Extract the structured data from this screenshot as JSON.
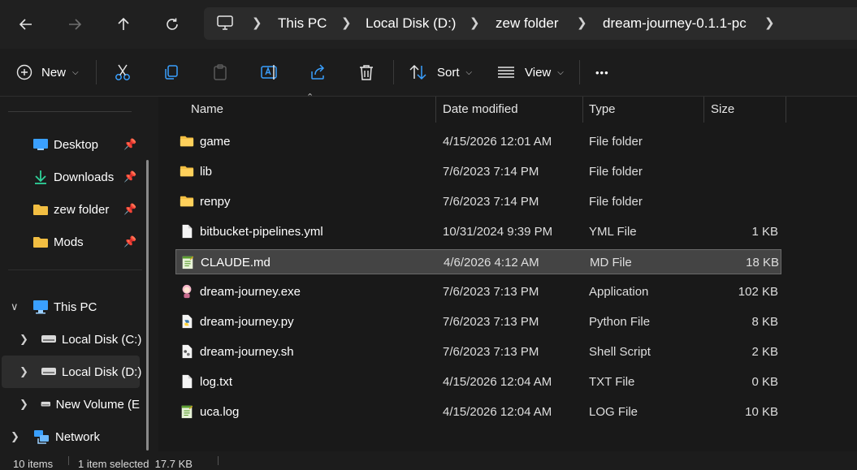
{
  "nav": {
    "back_icon": "arrow-left-icon",
    "forward_icon": "arrow-right-icon",
    "up_icon": "arrow-up-icon",
    "refresh_icon": "refresh-icon"
  },
  "breadcrumb": [
    "This PC",
    "Local Disk (D:)",
    "zew folder",
    "dream-journey-0.1.1-pc"
  ],
  "toolbar": {
    "new_label": "New",
    "sort_label": "Sort",
    "view_label": "View",
    "more_label": "•••"
  },
  "sidebar": {
    "quick": [
      {
        "label": "Desktop",
        "icon": "desktop-icon"
      },
      {
        "label": "Downloads",
        "icon": "download-icon"
      },
      {
        "label": "zew folder",
        "icon": "folder-icon"
      },
      {
        "label": "Mods",
        "icon": "folder-icon"
      }
    ],
    "this_pc": "This PC",
    "drives": [
      "Local Disk (C:)",
      "Local Disk (D:)",
      "New Volume (E"
    ],
    "network": "Network"
  },
  "columns": {
    "name": "Name",
    "date": "Date modified",
    "type": "Type",
    "size": "Size"
  },
  "files": [
    {
      "name": "game",
      "date": "4/15/2026 12:01 AM",
      "type": "File folder",
      "size": "",
      "icon": "folder"
    },
    {
      "name": "lib",
      "date": "7/6/2023 7:14 PM",
      "type": "File folder",
      "size": "",
      "icon": "folder"
    },
    {
      "name": "renpy",
      "date": "7/6/2023 7:14 PM",
      "type": "File folder",
      "size": "",
      "icon": "folder"
    },
    {
      "name": "bitbucket-pipelines.yml",
      "date": "10/31/2024 9:39 PM",
      "type": "YML File",
      "size": "1 KB",
      "icon": "file"
    },
    {
      "name": "CLAUDE.md",
      "date": "4/6/2026 4:12 AM",
      "type": "MD File",
      "size": "18 KB",
      "icon": "notepad",
      "selected": true
    },
    {
      "name": "dream-journey.exe",
      "date": "7/6/2023 7:13 PM",
      "type": "Application",
      "size": "102 KB",
      "icon": "app"
    },
    {
      "name": "dream-journey.py",
      "date": "7/6/2023 7:13 PM",
      "type": "Python File",
      "size": "8 KB",
      "icon": "python"
    },
    {
      "name": "dream-journey.sh",
      "date": "7/6/2023 7:13 PM",
      "type": "Shell Script",
      "size": "2 KB",
      "icon": "shell"
    },
    {
      "name": "log.txt",
      "date": "4/15/2026 12:04 AM",
      "type": "TXT File",
      "size": "0 KB",
      "icon": "file"
    },
    {
      "name": "uca.log",
      "date": "4/15/2026 12:04 AM",
      "type": "LOG File",
      "size": "10 KB",
      "icon": "notepad"
    }
  ],
  "status": {
    "count": "10 items",
    "selection": "1 item selected  17.7 KB"
  }
}
